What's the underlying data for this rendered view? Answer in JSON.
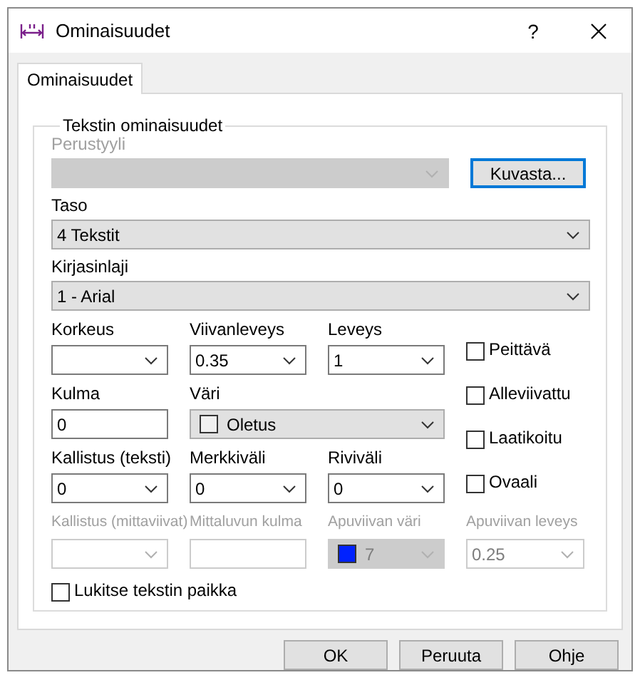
{
  "window": {
    "title": "Ominaisuudet",
    "help": "?"
  },
  "tabs": [
    {
      "label": "Ominaisuudet",
      "selected": true
    }
  ],
  "group": {
    "title": "Tekstin ominaisuudet"
  },
  "wide_fields": [
    {
      "label": "Perustyyli",
      "kind": "dropdown",
      "disabled": true,
      "button": "Kuvasta..."
    },
    {
      "label": "Taso",
      "kind": "dropdown",
      "value": "4 Tekstit",
      "disabled": false
    },
    {
      "label": "Kirjasinlaji",
      "kind": "dropdown",
      "value": "1 - Arial",
      "disabled": false
    }
  ],
  "grid_fields": [
    {
      "label": "Korkeus",
      "kind": "combo",
      "disabled": false
    },
    {
      "label": "Viivanleveys",
      "kind": "combo",
      "value": "0.35",
      "disabled": false
    },
    {
      "label": "Leveys",
      "kind": "combo",
      "value": "1",
      "disabled": false
    },
    {
      "label": "Kulma",
      "kind": "text",
      "value": "0",
      "disabled": false
    },
    {
      "label": "Väri",
      "kind": "color",
      "value": "Oletus",
      "color": "#f0f0f0",
      "wide": true,
      "disabled": false
    },
    {
      "label": "Kallistus (teksti)",
      "kind": "combo",
      "value": "0",
      "disabled": false
    },
    {
      "label": "Merkkiväli",
      "kind": "combo",
      "value": "0",
      "disabled": false
    },
    {
      "label": "Riviväli",
      "kind": "combo",
      "value": "0",
      "disabled": false
    },
    {
      "label": "Kallistus (mittaviivat)",
      "kind": "combo",
      "disabled": true
    },
    {
      "label": "Mittaluvun kulma",
      "kind": "text",
      "disabled": true
    },
    {
      "label": "Apuviivan väri",
      "kind": "color",
      "value": "7",
      "color": "#0022ff",
      "disabled": true
    },
    {
      "label": "Apuviivan leveys",
      "kind": "combo",
      "value": "0.25",
      "disabled": true
    }
  ],
  "checkboxes": [
    {
      "label": "Peittävä",
      "checked": false
    },
    {
      "label": "Alleviivattu",
      "checked": false
    },
    {
      "label": "Laatikoitu",
      "checked": false
    },
    {
      "label": "Ovaali",
      "checked": false
    }
  ],
  "lock": {
    "label": "Lukitse tekstin paikka",
    "checked": false
  },
  "buttons": [
    {
      "label": "OK"
    },
    {
      "label": "Peruuta"
    },
    {
      "label": "Ohje"
    }
  ]
}
